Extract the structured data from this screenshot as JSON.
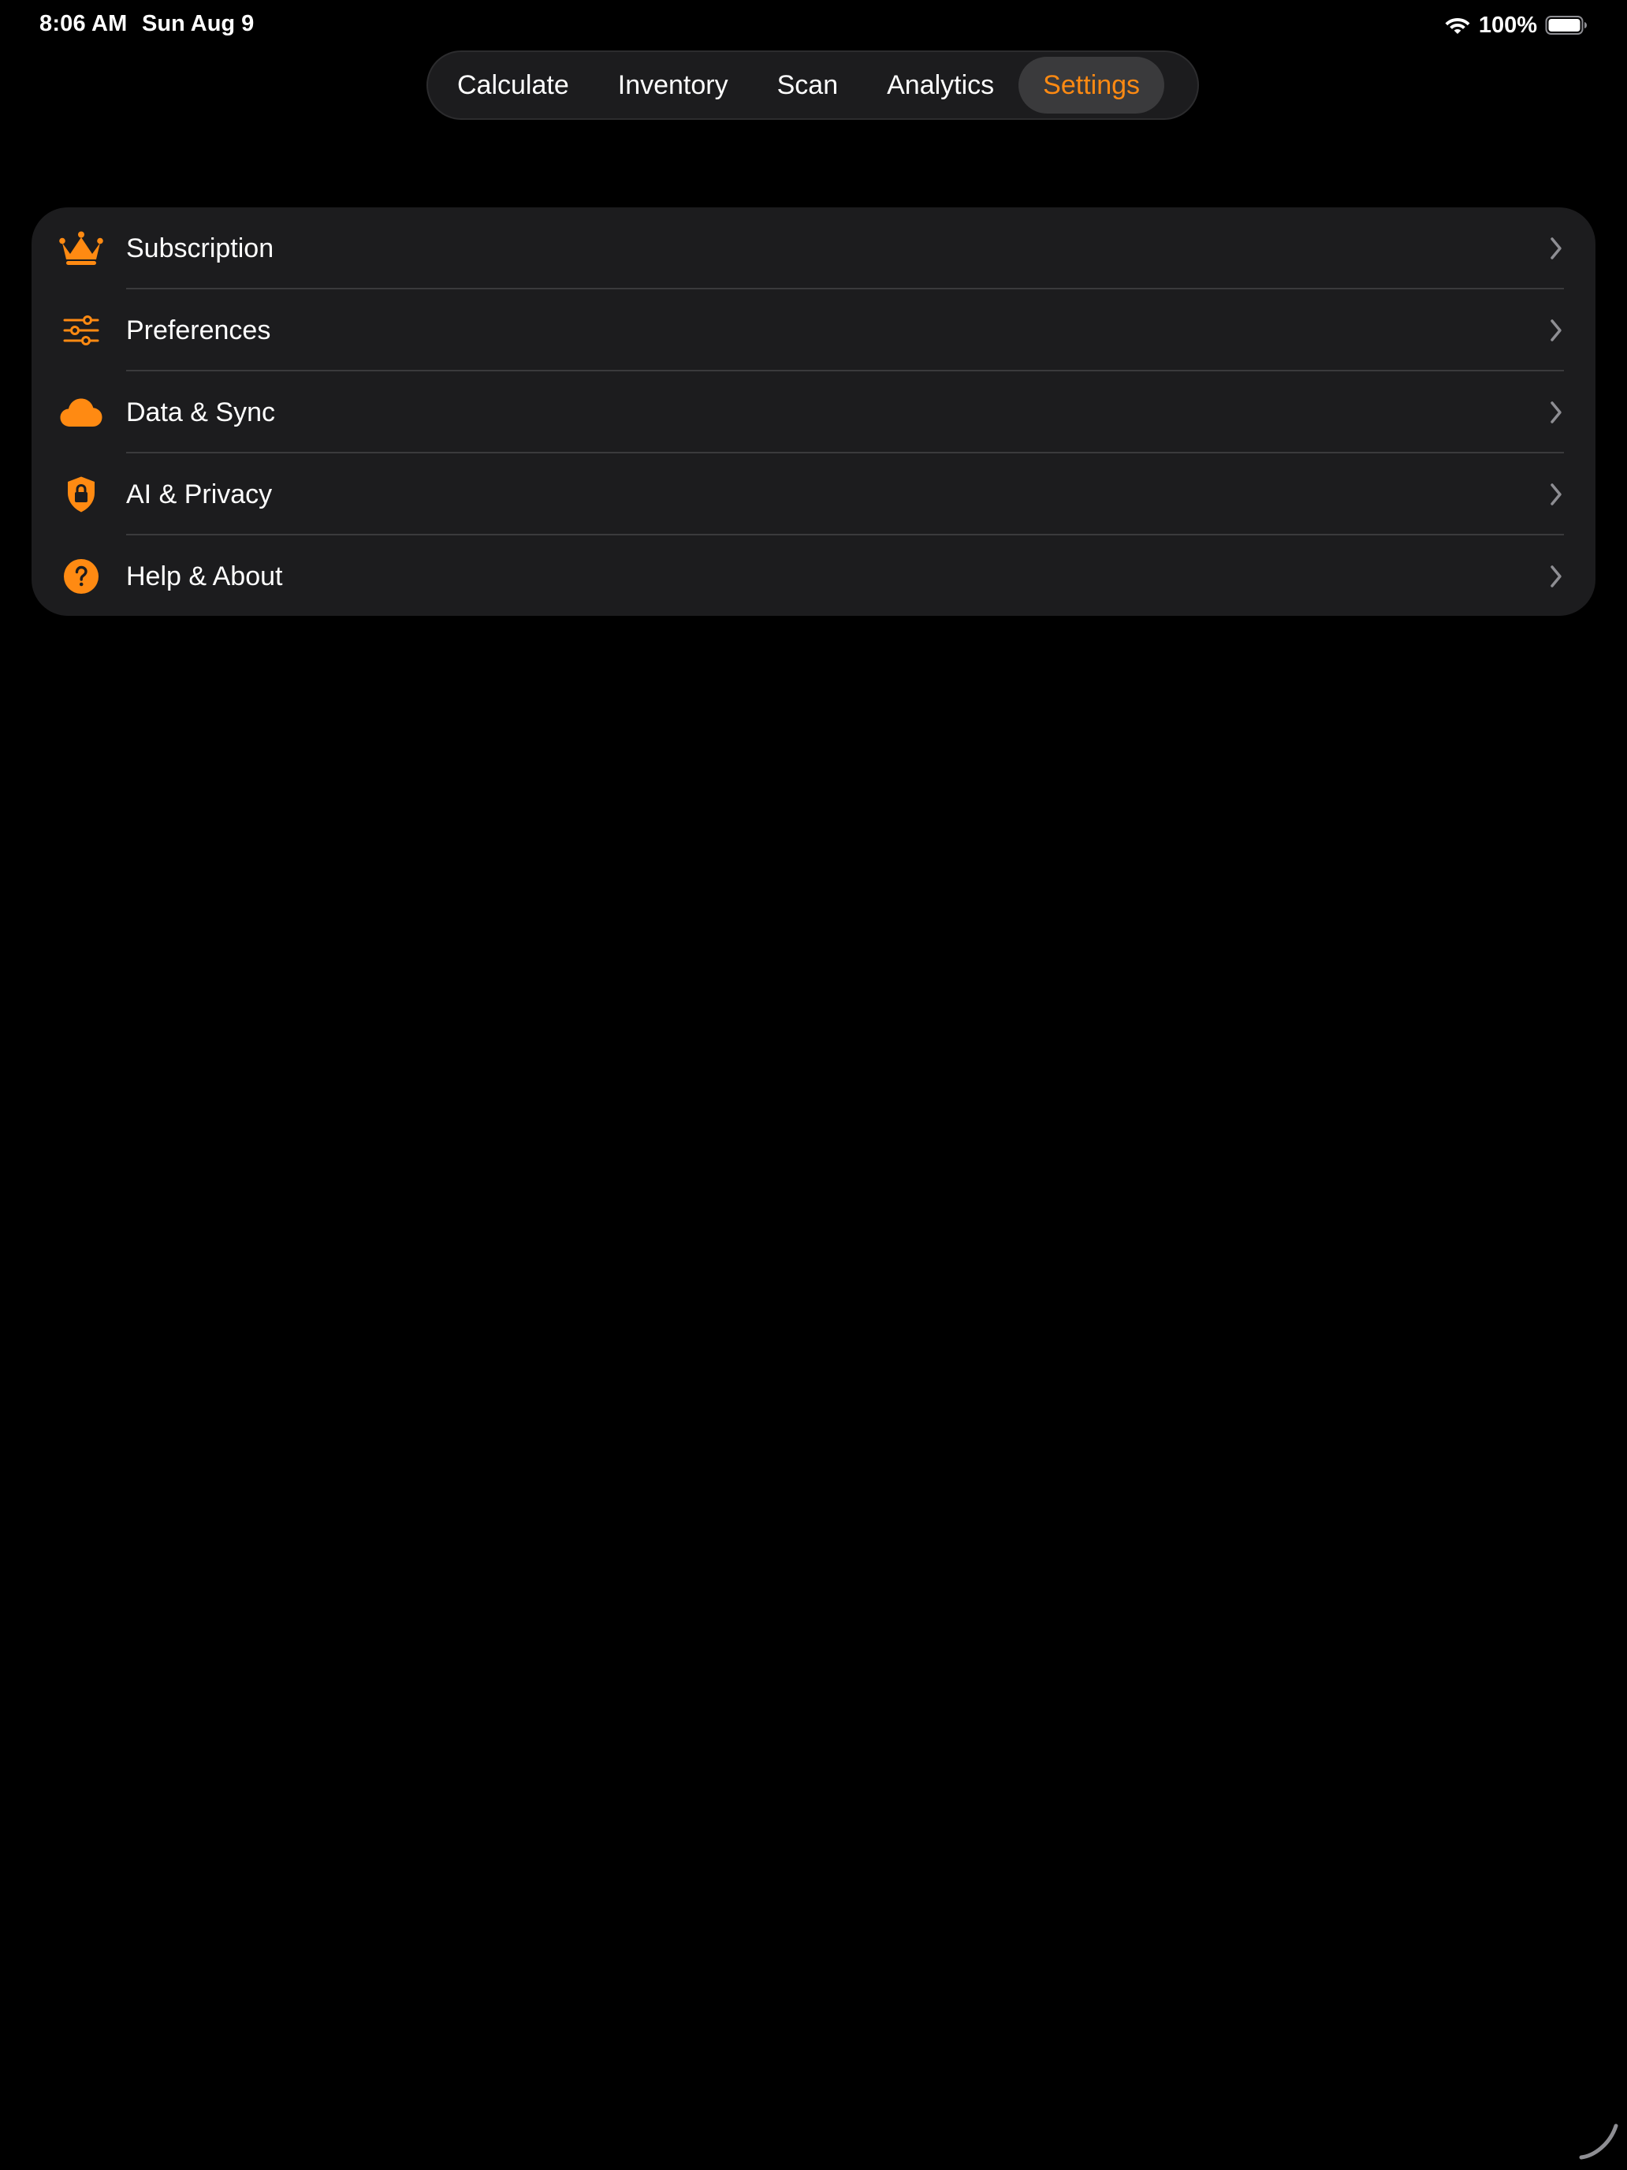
{
  "status_bar": {
    "time": "8:06 AM",
    "date": "Sun Aug 9",
    "battery_percent": "100%",
    "icons": [
      "wifi-icon",
      "battery-icon"
    ]
  },
  "tabs": [
    {
      "label": "Calculate",
      "active": false
    },
    {
      "label": "Inventory",
      "active": false
    },
    {
      "label": "Scan",
      "active": false
    },
    {
      "label": "Analytics",
      "active": false
    },
    {
      "label": "Settings",
      "active": true
    }
  ],
  "settings": {
    "items": [
      {
        "label": "Subscription",
        "icon": "crown-icon"
      },
      {
        "label": "Preferences",
        "icon": "sliders-icon"
      },
      {
        "label": "Data & Sync",
        "icon": "cloud-icon"
      },
      {
        "label": "AI & Privacy",
        "icon": "lock-shield-icon"
      },
      {
        "label": "Help & About",
        "icon": "question-circle-icon"
      }
    ]
  },
  "colors": {
    "accent": "#FF8A12",
    "background": "#000000",
    "card": "#1C1C1E",
    "divider": "#3A3A3C",
    "chevron": "#8E8E93"
  }
}
